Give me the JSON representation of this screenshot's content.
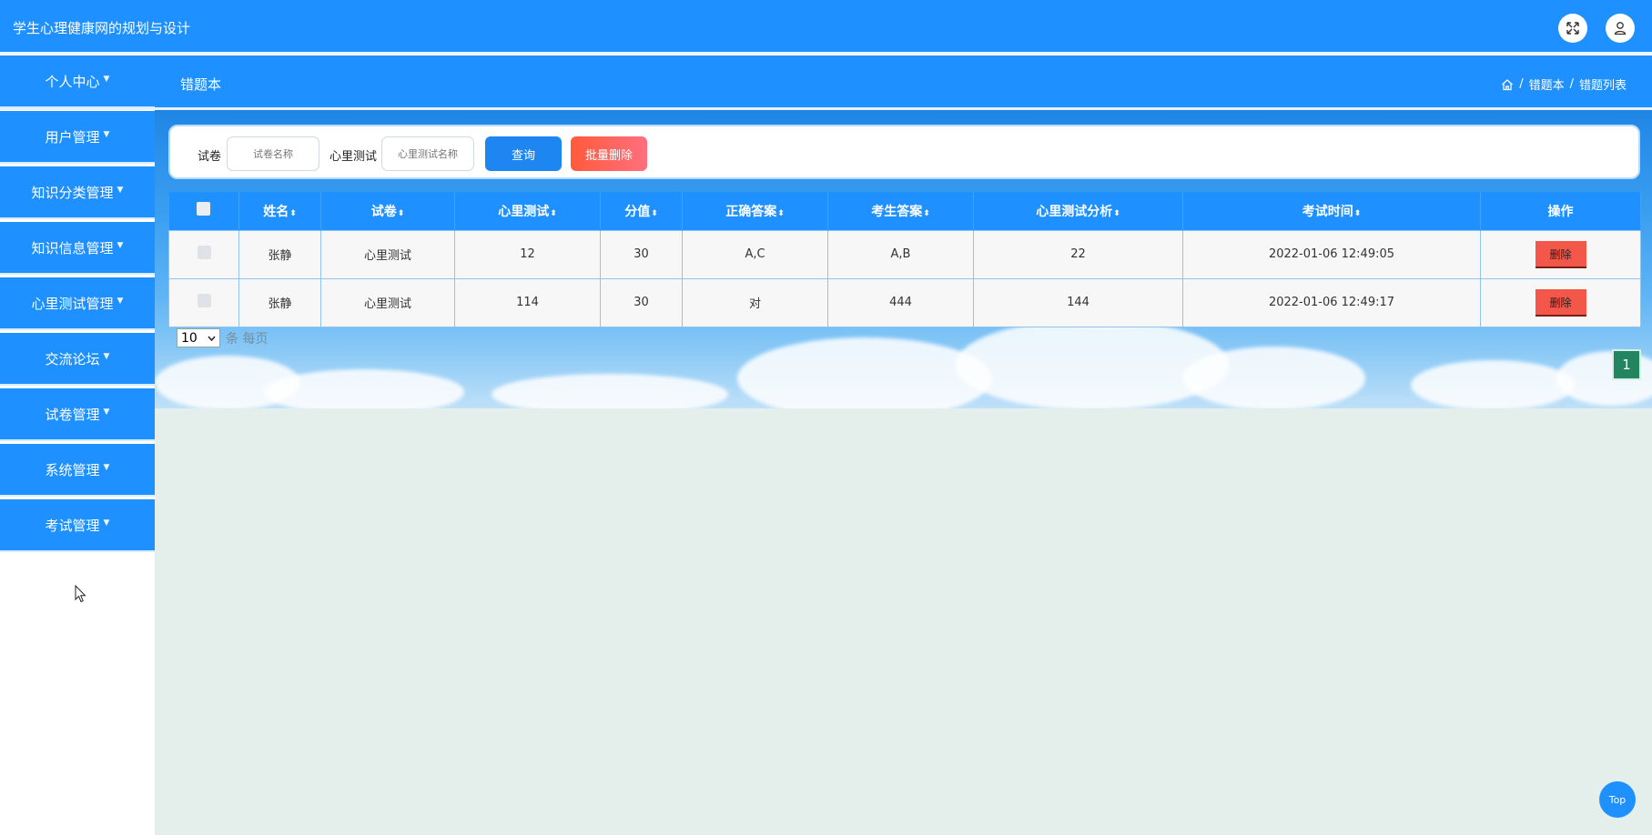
{
  "header": {
    "app_title": "学生心理健康网的规划与设计"
  },
  "subbar": {
    "title": "错题本",
    "breadcrumb": [
      "错题本",
      "错题列表"
    ],
    "separator": "/"
  },
  "sidebar": {
    "items": [
      {
        "label": "个人中心"
      },
      {
        "label": "用户管理"
      },
      {
        "label": "知识分类管理"
      },
      {
        "label": "知识信息管理"
      },
      {
        "label": "心里测试管理"
      },
      {
        "label": "交流论坛"
      },
      {
        "label": "试卷管理"
      },
      {
        "label": "系统管理"
      },
      {
        "label": "考试管理"
      }
    ]
  },
  "search": {
    "paper_label": "试卷",
    "paper_placeholder": "试卷名称",
    "test_label": "心里测试",
    "test_placeholder": "心里测试名称",
    "query_button": "查询",
    "batch_delete_button": "批量删除"
  },
  "table": {
    "columns": [
      "姓名",
      "试卷",
      "心里测试",
      "分值",
      "正确答案",
      "考生答案",
      "心里测试分析",
      "考试时间",
      "操作"
    ],
    "sort_glyph": "⬍",
    "rows": [
      {
        "name": "张静",
        "paper": "心里测试",
        "test": "12",
        "score": "30",
        "correct": "A,C",
        "answer": "A,B",
        "analysis": "22",
        "time": "2022-01-06 12:49:05",
        "action": "删除"
      },
      {
        "name": "张静",
        "paper": "心里测试",
        "test": "114",
        "score": "30",
        "correct": "对",
        "answer": "444",
        "analysis": "144",
        "time": "2022-01-06 12:49:17",
        "action": "删除"
      }
    ]
  },
  "pagination": {
    "per_page_value": "10",
    "per_page_text": "条 每页",
    "current_page": "1"
  },
  "top_button": "Top",
  "colors": {
    "primary": "#1e90ff",
    "danger": "#f2574a",
    "batch_delete": "#ff6a3d",
    "page_active": "#23855f",
    "content_bg": "#e4efeb"
  }
}
